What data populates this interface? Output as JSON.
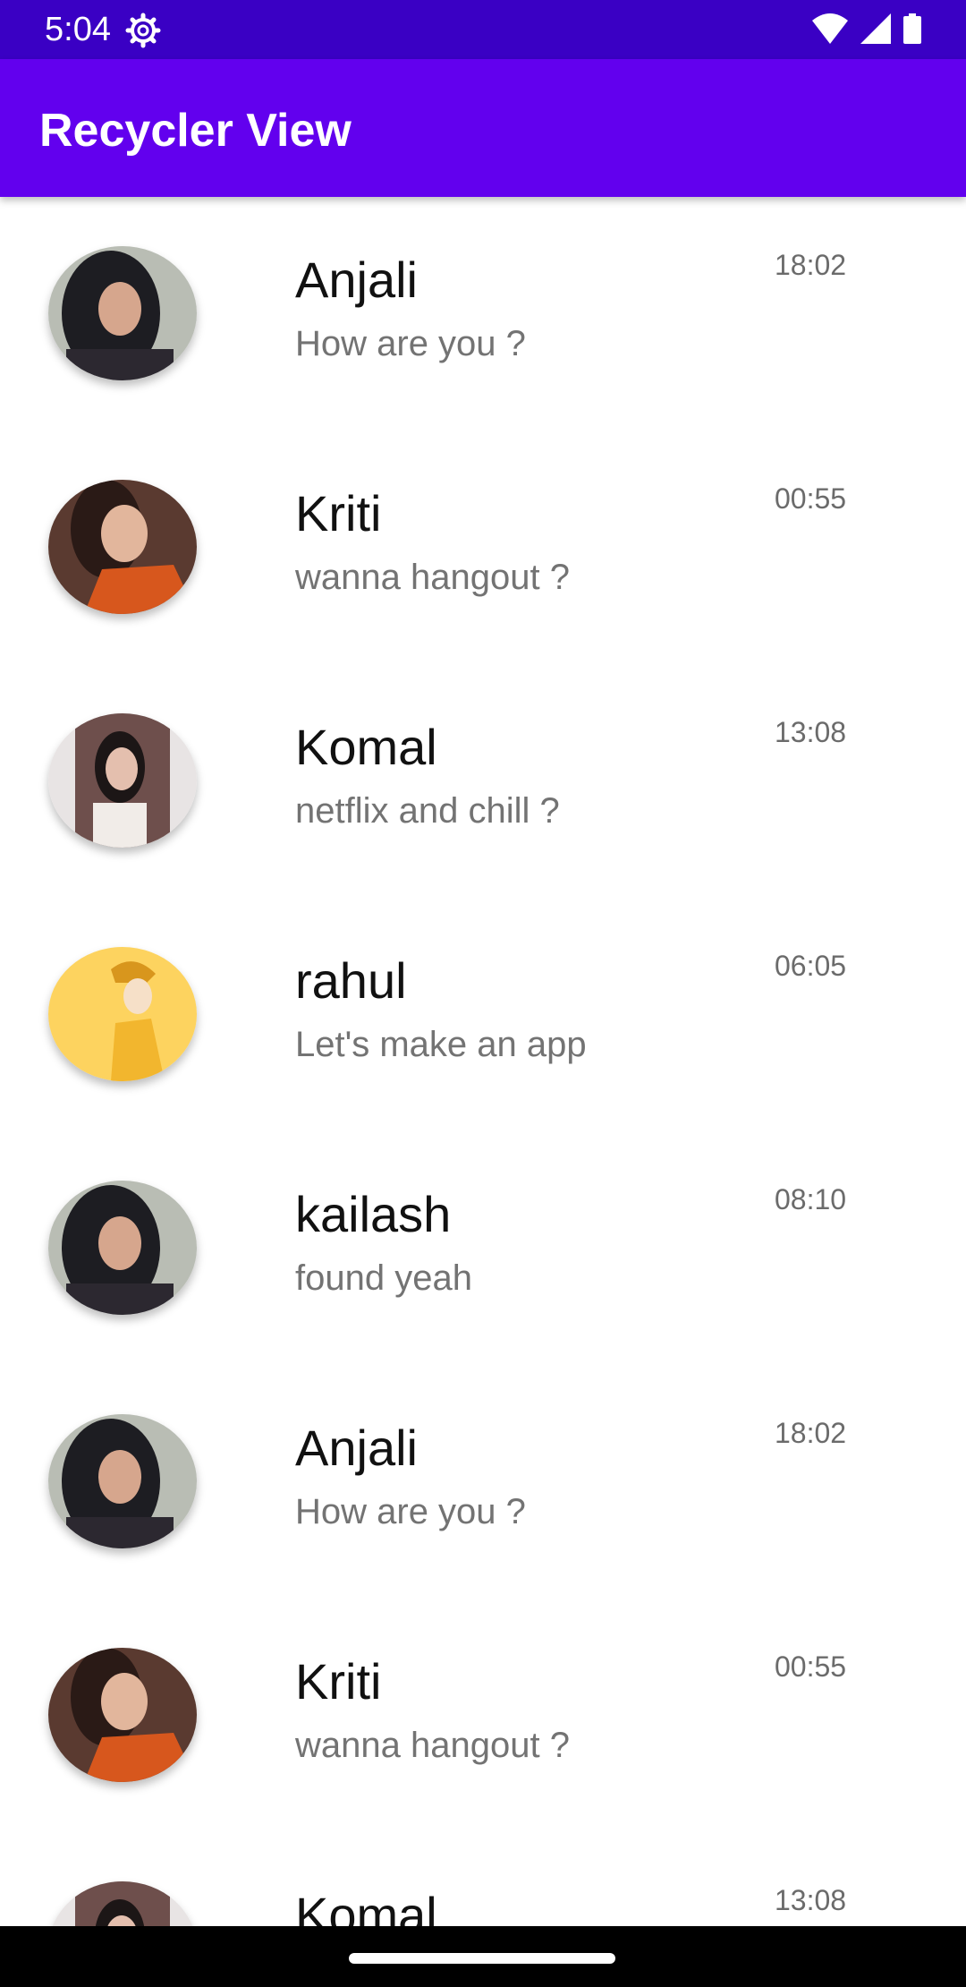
{
  "status_bar": {
    "time": "5:04",
    "icons": [
      "gear-icon",
      "wifi-icon",
      "signal-icon",
      "battery-icon"
    ]
  },
  "app_bar": {
    "title": "Recycler View",
    "color": "#6200ee"
  },
  "chats": [
    {
      "name": "Anjali",
      "message": "How are you ?",
      "time": "18:02",
      "avatar": "photo-woman-dark-hair"
    },
    {
      "name": "Kriti",
      "message": "wanna hangout ?",
      "time": "00:55",
      "avatar": "photo-woman-orange-scarf"
    },
    {
      "name": "Komal",
      "message": "netflix and chill ?",
      "time": "13:08",
      "avatar": "photo-woman-selfie"
    },
    {
      "name": "rahul",
      "message": "Let's make an app",
      "time": "06:05",
      "avatar": "illustration-man-cap"
    },
    {
      "name": "kailash",
      "message": "found yeah",
      "time": "08:10",
      "avatar": "photo-woman-dark-hair"
    },
    {
      "name": "Anjali",
      "message": "How are you ?",
      "time": "18:02",
      "avatar": "photo-woman-dark-hair"
    },
    {
      "name": "Kriti",
      "message": "wanna hangout ?",
      "time": "00:55",
      "avatar": "photo-woman-orange-scarf"
    },
    {
      "name": "Komal",
      "message": "",
      "time": "13:08",
      "avatar": "photo-woman-selfie"
    }
  ]
}
